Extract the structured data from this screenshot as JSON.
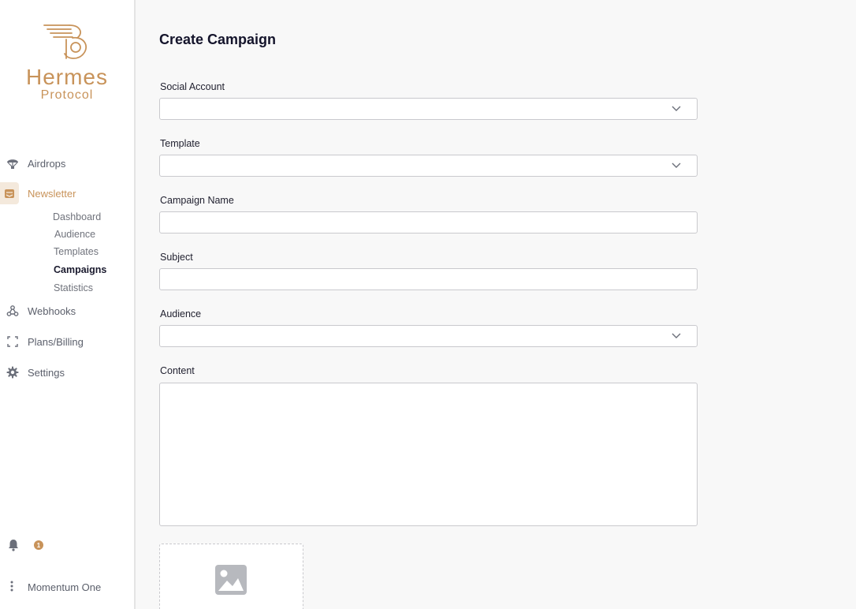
{
  "brand": {
    "title": "Hermes",
    "subtitle": "Protocol",
    "color": "#c8935a"
  },
  "sidebar": {
    "items": [
      {
        "label": "Airdrops",
        "icon": "parachute-icon"
      },
      {
        "label": "Newsletter",
        "icon": "envelope-open-icon",
        "active": true
      },
      {
        "label": "Webhooks",
        "icon": "webhook-icon"
      },
      {
        "label": "Plans/Billing",
        "icon": "expand-frame-icon"
      },
      {
        "label": "Settings",
        "icon": "gear-icon"
      }
    ],
    "newsletter_sub": [
      {
        "label": "Dashboard"
      },
      {
        "label": "Audience"
      },
      {
        "label": "Templates"
      },
      {
        "label": "Campaigns",
        "current": true
      },
      {
        "label": "Statistics"
      }
    ],
    "notifications_count": "1",
    "user_name": "Momentum One"
  },
  "form": {
    "title": "Create Campaign",
    "social_account_label": "Social Account",
    "social_account_value": "",
    "template_label": "Template",
    "template_value": "",
    "campaign_name_label": "Campaign Name",
    "campaign_name_value": "",
    "subject_label": "Subject",
    "subject_value": "",
    "audience_label": "Audience",
    "audience_value": "",
    "content_label": "Content",
    "content_value": ""
  }
}
